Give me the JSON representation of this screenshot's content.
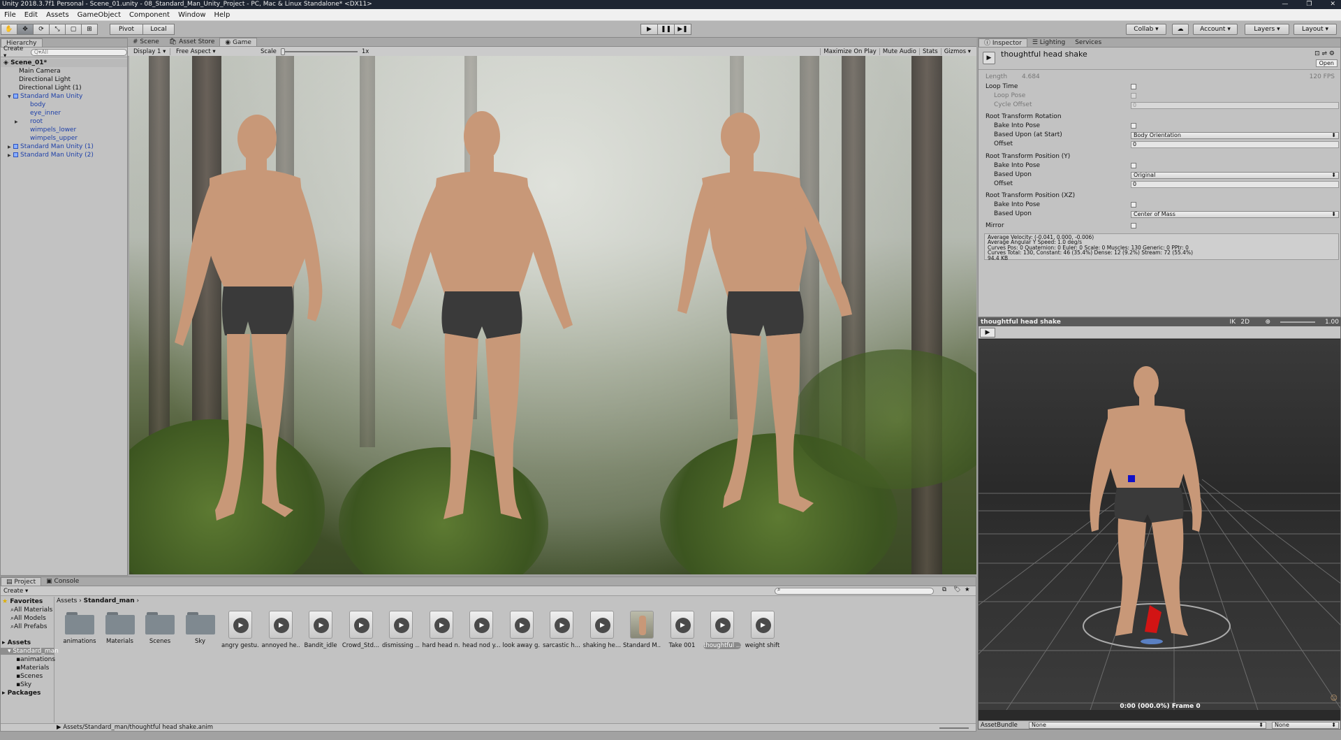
{
  "window_title": "Unity 2018.3.7f1 Personal - Scene_01.unity - 08_Standard_Man_Unity_Project - PC, Mac & Linux Standalone* <DX11>",
  "menu": [
    "File",
    "Edit",
    "Assets",
    "GameObject",
    "Component",
    "Window",
    "Help"
  ],
  "toolbar": {
    "pivot": "Pivot",
    "local": "Local",
    "collab": "Collab ▾",
    "account": "Account",
    "layers": "Layers",
    "layout": "Layout"
  },
  "hierarchy": {
    "tab": "Hierarchy",
    "create": "Create ▾",
    "search_placeholder": "Q▾All",
    "scene": "Scene_01*",
    "items": [
      {
        "label": "Main Camera"
      },
      {
        "label": "Directional Light"
      },
      {
        "label": "Directional Light (1)"
      },
      {
        "label": "Standard Man Unity"
      },
      {
        "label": "body"
      },
      {
        "label": "eye_inner"
      },
      {
        "label": "root"
      },
      {
        "label": "wimpels_lower"
      },
      {
        "label": "wimpels_upper"
      },
      {
        "label": "Standard Man Unity (1)"
      },
      {
        "label": "Standard Man Unity (2)"
      }
    ]
  },
  "center_tabs": [
    "Scene",
    "Asset Store",
    "Game"
  ],
  "game_bar": {
    "display": "Display 1",
    "aspect": "Free Aspect",
    "scale_label": "Scale",
    "scale_value": "1x",
    "maximize": "Maximize On Play",
    "mute": "Mute Audio",
    "stats": "Stats",
    "gizmos": "Gizmos"
  },
  "inspector": {
    "tabs": [
      "Inspector",
      "Lighting",
      "Services"
    ],
    "asset_name": "thoughtful head shake",
    "open_button": "Open",
    "length_label": "Length",
    "length_value": "4.684",
    "fps": "120 FPS",
    "loop_time": "Loop Time",
    "loop_pose": "Loop Pose",
    "cycle_offset": "Cycle Offset",
    "cycle_offset_value": "0",
    "rt_rotation": "Root Transform Rotation",
    "bake_into_pose": "Bake Into Pose",
    "based_upon_start": "Based Upon (at Start)",
    "body_orientation": "Body Orientation",
    "offset": "Offset",
    "offset_value": "0",
    "rt_position_y": "Root Transform Position (Y)",
    "based_upon": "Based Upon",
    "original": "Original",
    "rt_position_xz": "Root Transform Position (XZ)",
    "center_of_mass": "Center of Mass",
    "mirror": "Mirror",
    "info_lines": [
      "Average Velocity: (-0.041, 0.000, -0.006)",
      "Average Angular Y Speed: 1.0 deg/s",
      "Curves Pos: 0 Quaternion: 0 Euler: 0 Scale: 0 Muscles: 130 Generic: 0 PPtr: 0",
      "Curves Total: 130, Constant: 46 (35.4%) Dense: 12 (9.2%) Stream: 72 (55.4%)",
      "94.4 KB"
    ]
  },
  "preview": {
    "title": "thoughtful head shake",
    "ik": "IK",
    "two_d": "2D",
    "speed": "1.00",
    "time_readout": "0:00 (000.0%) Frame 0",
    "assetbundle_label": "AssetBundle",
    "assetbundle_value": "None",
    "variant_value": "None"
  },
  "project": {
    "tabs": [
      "Project",
      "Console"
    ],
    "create": "Create ▾",
    "breadcrumb": [
      "Assets",
      "Standard_man"
    ],
    "favorites": "Favorites",
    "fav_items": [
      "All Materials",
      "All Models",
      "All Prefabs"
    ],
    "assets_root": "Assets",
    "tree_items": [
      "Standard_man",
      "animations",
      "Materials",
      "Scenes",
      "Sky"
    ],
    "packages": "Packages",
    "assets": [
      {
        "name": "animations",
        "kind": "folder"
      },
      {
        "name": "Materials",
        "kind": "folder"
      },
      {
        "name": "Scenes",
        "kind": "folder"
      },
      {
        "name": "Sky",
        "kind": "folder"
      },
      {
        "name": "angry gestu...",
        "kind": "anim"
      },
      {
        "name": "annoyed he...",
        "kind": "anim"
      },
      {
        "name": "Bandit_idle",
        "kind": "anim"
      },
      {
        "name": "Crowd_Std...",
        "kind": "anim"
      },
      {
        "name": "dismissing ...",
        "kind": "anim"
      },
      {
        "name": "hard head n...",
        "kind": "anim"
      },
      {
        "name": "head nod y...",
        "kind": "anim"
      },
      {
        "name": "look away g...",
        "kind": "anim"
      },
      {
        "name": "sarcastic h...",
        "kind": "anim"
      },
      {
        "name": "shaking he...",
        "kind": "anim"
      },
      {
        "name": "Standard M...",
        "kind": "model"
      },
      {
        "name": "Take 001",
        "kind": "anim"
      },
      {
        "name": "thoughtful ...",
        "kind": "anim"
      },
      {
        "name": "weight shift",
        "kind": "anim"
      }
    ],
    "status_path": "Assets/Standard_man/thoughtful head shake.anim"
  },
  "colors": {
    "selection_blue": "#1d3fa8",
    "chrome": "#c2c2c2"
  }
}
